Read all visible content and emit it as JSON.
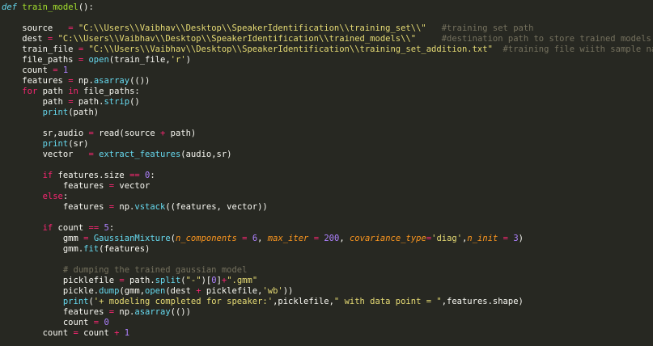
{
  "editor": {
    "theme": {
      "background": "#272822",
      "foreground": "#f8f8f2",
      "keyword": "#f92672",
      "function": "#a6e22e",
      "builtin": "#66d9ef",
      "string": "#e6db74",
      "number": "#ae81ff",
      "comment": "#75715e",
      "parameter": "#fd971f"
    },
    "lines": [
      [
        {
          "t": "def",
          "c": "kwi"
        },
        {
          "t": " ",
          "c": "id"
        },
        {
          "t": "train_model",
          "c": "fn"
        },
        {
          "t": "():",
          "c": "id"
        }
      ],
      [],
      [
        {
          "t": "    source   ",
          "c": "id"
        },
        {
          "t": "=",
          "c": "op"
        },
        {
          "t": " ",
          "c": "id"
        },
        {
          "t": "\"C:\\\\Users\\\\Vaibhav\\\\Desktop\\\\SpeakerIdentification\\\\training_set\\\\\"",
          "c": "str"
        },
        {
          "t": "   ",
          "c": "id"
        },
        {
          "t": "#training set path",
          "c": "cm"
        }
      ],
      [
        {
          "t": "    dest ",
          "c": "id"
        },
        {
          "t": "=",
          "c": "op"
        },
        {
          "t": " ",
          "c": "id"
        },
        {
          "t": "\"C:\\\\Users\\\\Vaibhav\\\\Desktop\\\\SpeakerIdentification\\\\trained_models\\\\\"",
          "c": "str"
        },
        {
          "t": "     ",
          "c": "id"
        },
        {
          "t": "#destination path to store trained models",
          "c": "cm"
        }
      ],
      [
        {
          "t": "    train_file ",
          "c": "id"
        },
        {
          "t": "=",
          "c": "op"
        },
        {
          "t": " ",
          "c": "id"
        },
        {
          "t": "\"C:\\\\Users\\\\Vaibhav\\\\Desktop\\\\SpeakerIdentification\\\\training_set_addition.txt\"",
          "c": "str"
        },
        {
          "t": "  ",
          "c": "id"
        },
        {
          "t": "#training file wiith sample names",
          "c": "cm"
        }
      ],
      [
        {
          "t": "    file_paths ",
          "c": "id"
        },
        {
          "t": "=",
          "c": "op"
        },
        {
          "t": " ",
          "c": "id"
        },
        {
          "t": "open",
          "c": "bi"
        },
        {
          "t": "(train_file,",
          "c": "id"
        },
        {
          "t": "'r'",
          "c": "str"
        },
        {
          "t": ")",
          "c": "id"
        }
      ],
      [
        {
          "t": "    count ",
          "c": "id"
        },
        {
          "t": "=",
          "c": "op"
        },
        {
          "t": " ",
          "c": "id"
        },
        {
          "t": "1",
          "c": "num"
        }
      ],
      [
        {
          "t": "    features ",
          "c": "id"
        },
        {
          "t": "=",
          "c": "op"
        },
        {
          "t": " np.",
          "c": "id"
        },
        {
          "t": "asarray",
          "c": "mcall"
        },
        {
          "t": "(())",
          "c": "id"
        }
      ],
      [
        {
          "t": "    ",
          "c": "id"
        },
        {
          "t": "for",
          "c": "kw"
        },
        {
          "t": " path ",
          "c": "id"
        },
        {
          "t": "in",
          "c": "kw"
        },
        {
          "t": " file_paths:",
          "c": "id"
        }
      ],
      [
        {
          "t": "        path ",
          "c": "id"
        },
        {
          "t": "=",
          "c": "op"
        },
        {
          "t": " path.",
          "c": "id"
        },
        {
          "t": "strip",
          "c": "mcall"
        },
        {
          "t": "()",
          "c": "id"
        }
      ],
      [
        {
          "t": "        ",
          "c": "id"
        },
        {
          "t": "print",
          "c": "bi"
        },
        {
          "t": "(path)",
          "c": "id"
        }
      ],
      [],
      [
        {
          "t": "        sr,audio ",
          "c": "id"
        },
        {
          "t": "=",
          "c": "op"
        },
        {
          "t": " read(source ",
          "c": "id"
        },
        {
          "t": "+",
          "c": "op"
        },
        {
          "t": " path)",
          "c": "id"
        }
      ],
      [
        {
          "t": "        ",
          "c": "id"
        },
        {
          "t": "print",
          "c": "bi"
        },
        {
          "t": "(sr)",
          "c": "id"
        }
      ],
      [
        {
          "t": "        vector   ",
          "c": "id"
        },
        {
          "t": "=",
          "c": "op"
        },
        {
          "t": " ",
          "c": "id"
        },
        {
          "t": "extract_features",
          "c": "bi"
        },
        {
          "t": "(audio,sr)",
          "c": "id"
        }
      ],
      [],
      [
        {
          "t": "        ",
          "c": "id"
        },
        {
          "t": "if",
          "c": "kw"
        },
        {
          "t": " features.size ",
          "c": "id"
        },
        {
          "t": "==",
          "c": "op"
        },
        {
          "t": " ",
          "c": "id"
        },
        {
          "t": "0",
          "c": "num"
        },
        {
          "t": ":",
          "c": "id"
        }
      ],
      [
        {
          "t": "            features ",
          "c": "id"
        },
        {
          "t": "=",
          "c": "op"
        },
        {
          "t": " vector",
          "c": "id"
        }
      ],
      [
        {
          "t": "        ",
          "c": "id"
        },
        {
          "t": "else",
          "c": "kw"
        },
        {
          "t": ":",
          "c": "id"
        }
      ],
      [
        {
          "t": "            features ",
          "c": "id"
        },
        {
          "t": "=",
          "c": "op"
        },
        {
          "t": " np.",
          "c": "id"
        },
        {
          "t": "vstack",
          "c": "mcall"
        },
        {
          "t": "((features, vector))",
          "c": "id"
        }
      ],
      [],
      [
        {
          "t": "        ",
          "c": "id"
        },
        {
          "t": "if",
          "c": "kw"
        },
        {
          "t": " count ",
          "c": "id"
        },
        {
          "t": "==",
          "c": "op"
        },
        {
          "t": " ",
          "c": "id"
        },
        {
          "t": "5",
          "c": "num"
        },
        {
          "t": ":",
          "c": "id"
        }
      ],
      [
        {
          "t": "            gmm ",
          "c": "id"
        },
        {
          "t": "=",
          "c": "op"
        },
        {
          "t": " ",
          "c": "id"
        },
        {
          "t": "GaussianMixture",
          "c": "bi"
        },
        {
          "t": "(",
          "c": "id"
        },
        {
          "t": "n_components",
          "c": "par"
        },
        {
          "t": " ",
          "c": "id"
        },
        {
          "t": "=",
          "c": "op"
        },
        {
          "t": " ",
          "c": "id"
        },
        {
          "t": "6",
          "c": "num"
        },
        {
          "t": ", ",
          "c": "id"
        },
        {
          "t": "max_iter",
          "c": "par"
        },
        {
          "t": " ",
          "c": "id"
        },
        {
          "t": "=",
          "c": "op"
        },
        {
          "t": " ",
          "c": "id"
        },
        {
          "t": "200",
          "c": "num"
        },
        {
          "t": ", ",
          "c": "id"
        },
        {
          "t": "covariance_type",
          "c": "par"
        },
        {
          "t": "=",
          "c": "op"
        },
        {
          "t": "'diag'",
          "c": "str"
        },
        {
          "t": ",",
          "c": "id"
        },
        {
          "t": "n_init",
          "c": "par"
        },
        {
          "t": " ",
          "c": "id"
        },
        {
          "t": "=",
          "c": "op"
        },
        {
          "t": " ",
          "c": "id"
        },
        {
          "t": "3",
          "c": "num"
        },
        {
          "t": ")",
          "c": "id"
        }
      ],
      [
        {
          "t": "            gmm.",
          "c": "id"
        },
        {
          "t": "fit",
          "c": "mcall"
        },
        {
          "t": "(features)",
          "c": "id"
        }
      ],
      [],
      [
        {
          "t": "            ",
          "c": "id"
        },
        {
          "t": "# dumping the trained gaussian model",
          "c": "cm"
        }
      ],
      [
        {
          "t": "            picklefile ",
          "c": "id"
        },
        {
          "t": "=",
          "c": "op"
        },
        {
          "t": " path.",
          "c": "id"
        },
        {
          "t": "split",
          "c": "mcall"
        },
        {
          "t": "(",
          "c": "id"
        },
        {
          "t": "\"-\"",
          "c": "str"
        },
        {
          "t": ")[",
          "c": "id"
        },
        {
          "t": "0",
          "c": "num"
        },
        {
          "t": "]",
          "c": "id"
        },
        {
          "t": "+",
          "c": "op"
        },
        {
          "t": "\".gmm\"",
          "c": "str"
        }
      ],
      [
        {
          "t": "            pickle.",
          "c": "id"
        },
        {
          "t": "dump",
          "c": "mcall"
        },
        {
          "t": "(gmm,",
          "c": "id"
        },
        {
          "t": "open",
          "c": "bi"
        },
        {
          "t": "(dest ",
          "c": "id"
        },
        {
          "t": "+",
          "c": "op"
        },
        {
          "t": " picklefile,",
          "c": "id"
        },
        {
          "t": "'wb'",
          "c": "str"
        },
        {
          "t": "))",
          "c": "id"
        }
      ],
      [
        {
          "t": "            ",
          "c": "id"
        },
        {
          "t": "print",
          "c": "bi"
        },
        {
          "t": "(",
          "c": "id"
        },
        {
          "t": "'+ modeling completed for speaker:'",
          "c": "str"
        },
        {
          "t": ",picklefile,",
          "c": "id"
        },
        {
          "t": "\" with data point = \"",
          "c": "str"
        },
        {
          "t": ",features.shape)",
          "c": "id"
        }
      ],
      [
        {
          "t": "            features ",
          "c": "id"
        },
        {
          "t": "=",
          "c": "op"
        },
        {
          "t": " np.",
          "c": "id"
        },
        {
          "t": "asarray",
          "c": "mcall"
        },
        {
          "t": "(())",
          "c": "id"
        }
      ],
      [
        {
          "t": "            count ",
          "c": "id"
        },
        {
          "t": "=",
          "c": "op"
        },
        {
          "t": " ",
          "c": "id"
        },
        {
          "t": "0",
          "c": "num"
        }
      ],
      [
        {
          "t": "        count ",
          "c": "id"
        },
        {
          "t": "=",
          "c": "op"
        },
        {
          "t": " count ",
          "c": "id"
        },
        {
          "t": "+",
          "c": "op"
        },
        {
          "t": " ",
          "c": "id"
        },
        {
          "t": "1",
          "c": "num"
        }
      ]
    ]
  }
}
